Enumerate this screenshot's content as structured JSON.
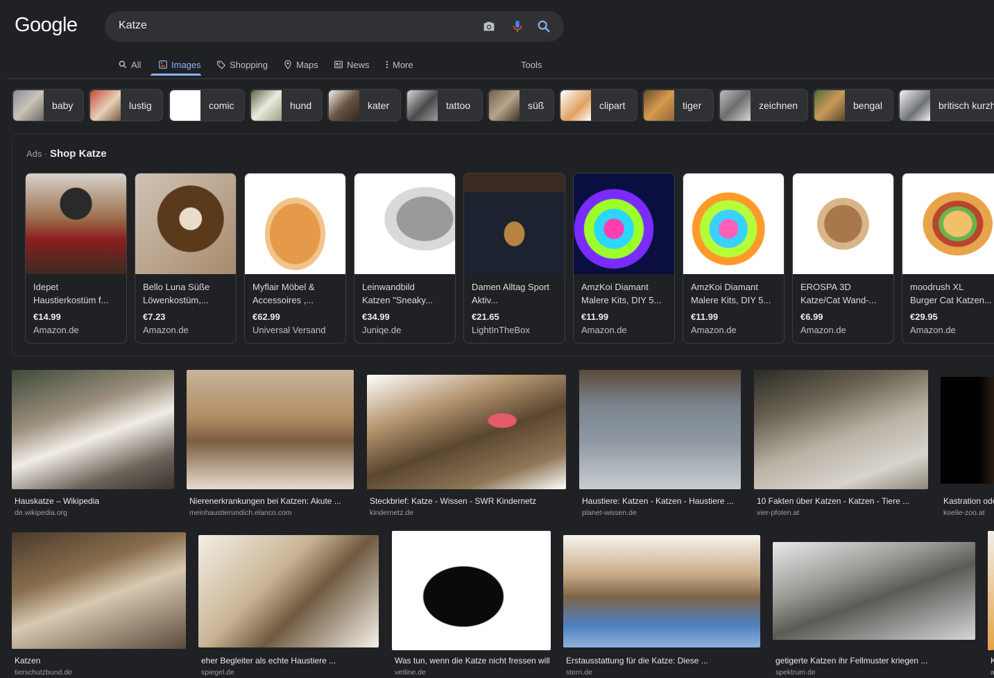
{
  "header": {
    "logo": "Google",
    "search_value": "Katze",
    "tabs": [
      {
        "label": "All",
        "icon": "search-icon"
      },
      {
        "label": "Images",
        "icon": "image-icon"
      },
      {
        "label": "Shopping",
        "icon": "tag-icon"
      },
      {
        "label": "Maps",
        "icon": "map-pin-icon"
      },
      {
        "label": "News",
        "icon": "news-icon"
      },
      {
        "label": "More",
        "icon": "more-vertical-icon"
      },
      {
        "label": "Tools"
      }
    ]
  },
  "chips": [
    "baby",
    "lustig",
    "comic",
    "hund",
    "kater",
    "tattoo",
    "süß",
    "clipart",
    "tiger",
    "zeichnen",
    "bengal",
    "britisch kurzhaar"
  ],
  "ads": {
    "label": "Ads",
    "title": "Shop Katze",
    "items": [
      {
        "l1": "Idepet",
        "l2": "Haustierkostüm f...",
        "price": "€14.99",
        "seller": "Amazon.de"
      },
      {
        "l1": "Bello Luna Süße",
        "l2": "Löwenkostüm,...",
        "price": "€7.23",
        "seller": "Amazon.de"
      },
      {
        "l1": "Myflair Möbel &",
        "l2": "Accessoires ,...",
        "price": "€62.99",
        "seller": "Universal Versand"
      },
      {
        "l1": "Leinwandbild",
        "l2": "Katzen \"Sneaky...",
        "price": "€34.99",
        "seller": "Juniqe.de"
      },
      {
        "l1": "Damen Alltag Sport",
        "l2": "Aktiv...",
        "price": "€21.65",
        "seller": "LightInTheBox"
      },
      {
        "l1": "AmzKoi Diamant",
        "l2": "Malere Kits, DIY 5...",
        "price": "€11.99",
        "seller": "Amazon.de"
      },
      {
        "l1": "AmzKoi Diamant",
        "l2": "Malere Kits, DIY 5...",
        "price": "€11.99",
        "seller": "Amazon.de"
      },
      {
        "l1": "EROSPA 3D",
        "l2": "Katze/Cat Wand-...",
        "price": "€6.99",
        "seller": "Amazon.de"
      },
      {
        "l1": "moodrush XL",
        "l2": "Burger Cat Katzen...",
        "price": "€29.95",
        "seller": "Amazon.de"
      }
    ]
  },
  "results_row1": [
    {
      "title": "Hauskatze – Wikipedia",
      "source": "de.wikipedia.org"
    },
    {
      "title": "Nierenerkrankungen bei Katzen: Akute ...",
      "source": "meinhaustierundich.elanco.com"
    },
    {
      "title": "Steckbrief: Katze - Wissen - SWR Kindernetz",
      "source": "kindernetz.de"
    },
    {
      "title": "Haustiere: Katzen - Katzen - Haustiere ...",
      "source": "planet-wissen.de"
    },
    {
      "title": "10 Fakten über Katzen - Katzen - Tiere ...",
      "source": "vier-pfoten.at"
    },
    {
      "title": "Kastration oder",
      "source": "koelle-zoo.at"
    }
  ],
  "results_row2": [
    {
      "title": "Katzen",
      "source": "tierschutzbund.de"
    },
    {
      "title": "eher Begleiter als echte Haustiere ...",
      "source": "spiegel.de"
    },
    {
      "title": "Was tun, wenn die Katze nicht fressen will",
      "source": "vetline.de"
    },
    {
      "title": "Erstausstattung für die Katze: Diese ...",
      "source": "stern.de"
    },
    {
      "title": "getigerte Katzen ihr Fellmuster kriegen ...",
      "source": "spektrum.de"
    },
    {
      "title": "K",
      "source": "a"
    }
  ]
}
